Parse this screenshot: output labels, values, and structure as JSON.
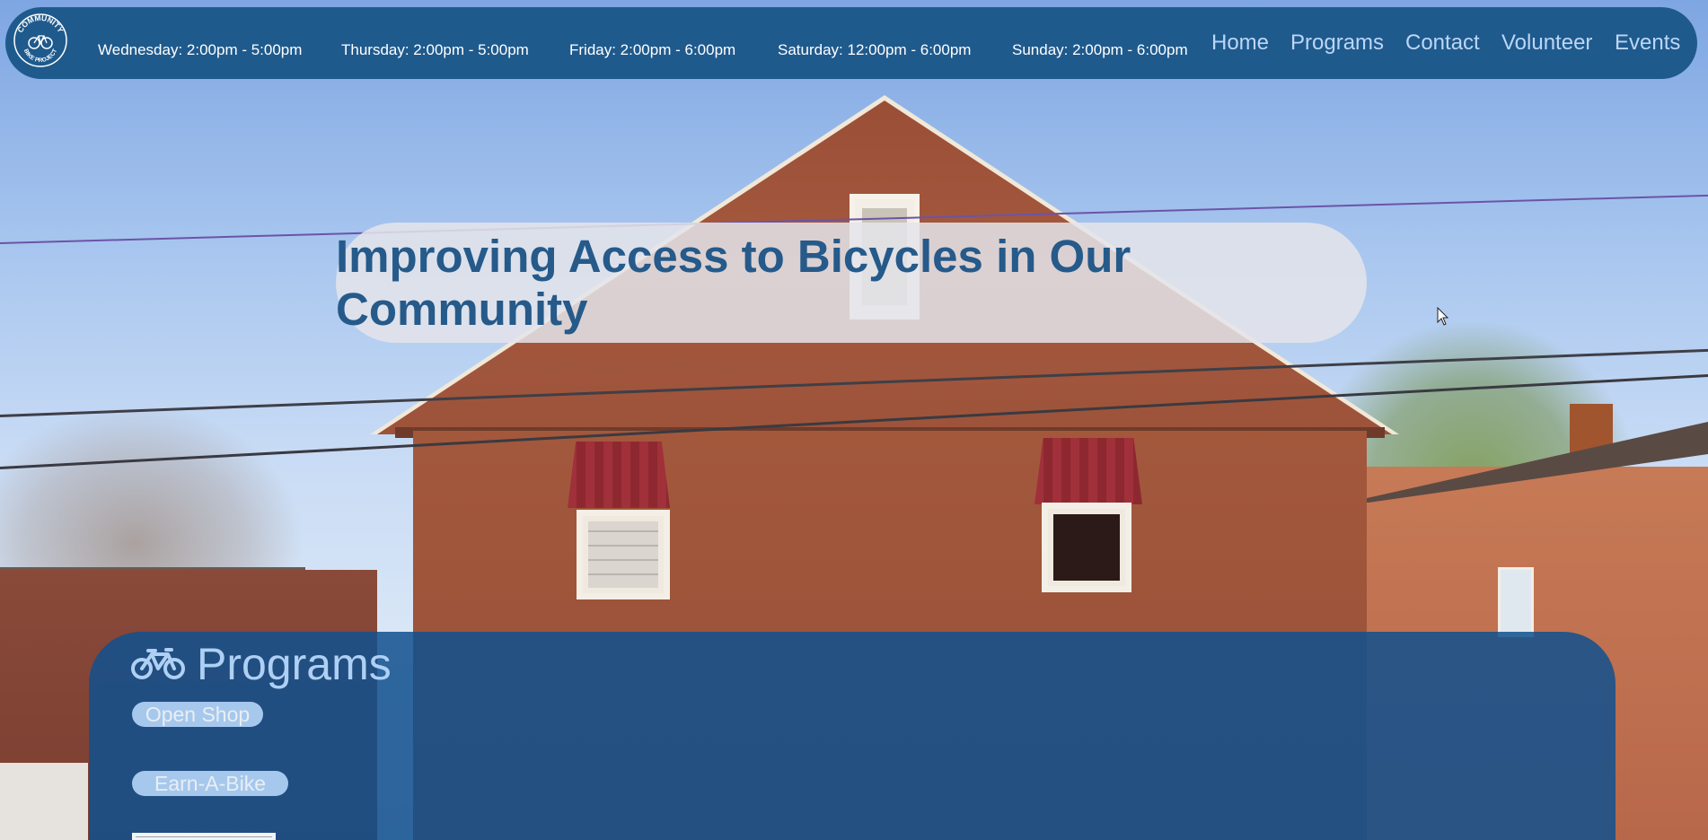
{
  "nav": {
    "logo": {
      "text_lines": [
        "COMMUNITY",
        "BIKE PROJECT"
      ],
      "icon": "bicycle-logo"
    },
    "hours": [
      "Wednesday: 2:00pm - 5:00pm",
      "Thursday: 2:00pm - 5:00pm",
      "Friday: 2:00pm - 6:00pm",
      "Saturday: 12:00pm - 6:00pm",
      "Sunday: 2:00pm - 6:00pm"
    ],
    "links": [
      "Home",
      "Programs",
      "Contact",
      "Volunteer",
      "Events"
    ]
  },
  "hero": {
    "title": "Improving Access to Bicycles in Our Community"
  },
  "programs": {
    "icon": "bicycle-icon",
    "title": "Programs",
    "buttons": [
      "Open Shop",
      "Earn-A-Bike"
    ]
  },
  "colors": {
    "nav_background": "#1f5a8d",
    "nav_link": "#bcd6f6",
    "hero_text": "#255a8a",
    "programs_panel": "#12508e",
    "pill_button": "#a6c8ed"
  }
}
